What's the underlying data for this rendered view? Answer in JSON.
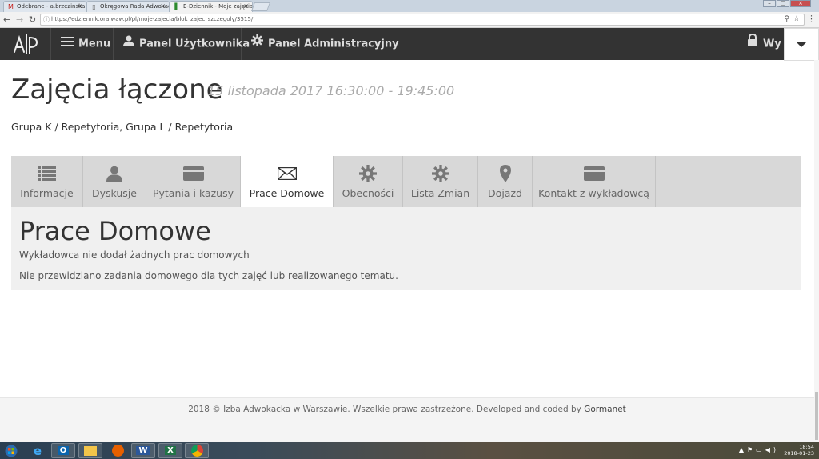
{
  "browser": {
    "tabs": [
      {
        "label": "Odebrane - a.brzezinska",
        "icon": "gmail-icon"
      },
      {
        "label": "Okręgowa Rada Adwokacka",
        "icon": "page-icon"
      },
      {
        "label": "E-Dziennik - Moje zajęcia",
        "icon": "edziennik-icon"
      }
    ],
    "url": "https://edziennik.ora.waw.pl/pl/moje-zajecia/blok_zajec_szczegoly/3515/"
  },
  "nav": {
    "menu": "Menu",
    "user_panel": "Panel Użytkownika",
    "admin_panel": "Panel Administracyjny",
    "right_truncated": "Wy"
  },
  "page": {
    "title": "Zajęcia łączone",
    "datetime": "15 listopada 2017 16:30:00 - 19:45:00",
    "groups": "Grupa K / Repetytoria,  Grupa L / Repetytoria"
  },
  "tabs": [
    {
      "label": "Informacje",
      "icon": "list-icon"
    },
    {
      "label": "Dyskusje",
      "icon": "user-icon"
    },
    {
      "label": "Pytania i kazusy",
      "icon": "card-icon"
    },
    {
      "label": "Prace Domowe",
      "icon": "envelope-icon"
    },
    {
      "label": "Obecności",
      "icon": "gear-icon"
    },
    {
      "label": "Lista Zmian",
      "icon": "gear-icon"
    },
    {
      "label": "Dojazd",
      "icon": "map-pin-icon"
    },
    {
      "label": "Kontakt z wykładowcą",
      "icon": "card-icon"
    }
  ],
  "active_tab": "Prace Domowe",
  "panel": {
    "heading": "Prace Domowe",
    "message1": "Wykładowca nie dodał żadnych prac domowych",
    "message2": "Nie przewidziano zadania domowego dla tych zajęć lub realizowanego tematu."
  },
  "footer": {
    "text": "2018 © Izba Adwokacka w Warszawie. Wszelkie prawa zastrzeżone. Developed and coded by ",
    "link": "Gormanet"
  },
  "taskbar": {
    "time": "18:54",
    "date": "2018-01-23"
  },
  "colors": {
    "nav_bg": "#333333",
    "tab_bg": "#d8d8d8",
    "panel_bg": "#f0f0f0"
  }
}
